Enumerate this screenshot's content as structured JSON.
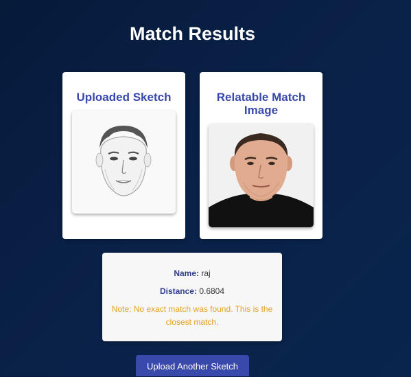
{
  "page": {
    "title": "Match Results"
  },
  "sketch_card": {
    "title": "Uploaded Sketch",
    "image_alt": "sketch-face"
  },
  "match_card": {
    "title": "Relatable Match Image",
    "image_alt": "matched-photo-face"
  },
  "result": {
    "name_label": "Name:",
    "name_value": "raj",
    "distance_label": "Distance:",
    "distance_value": "0.6804",
    "note": "Note: No exact match was found. This is the closest match."
  },
  "actions": {
    "upload_another_label": "Upload Another Sketch"
  },
  "colors": {
    "background": "#061a3a",
    "accent": "#3949ab",
    "note": "#e6a020",
    "card": "#ffffff"
  }
}
